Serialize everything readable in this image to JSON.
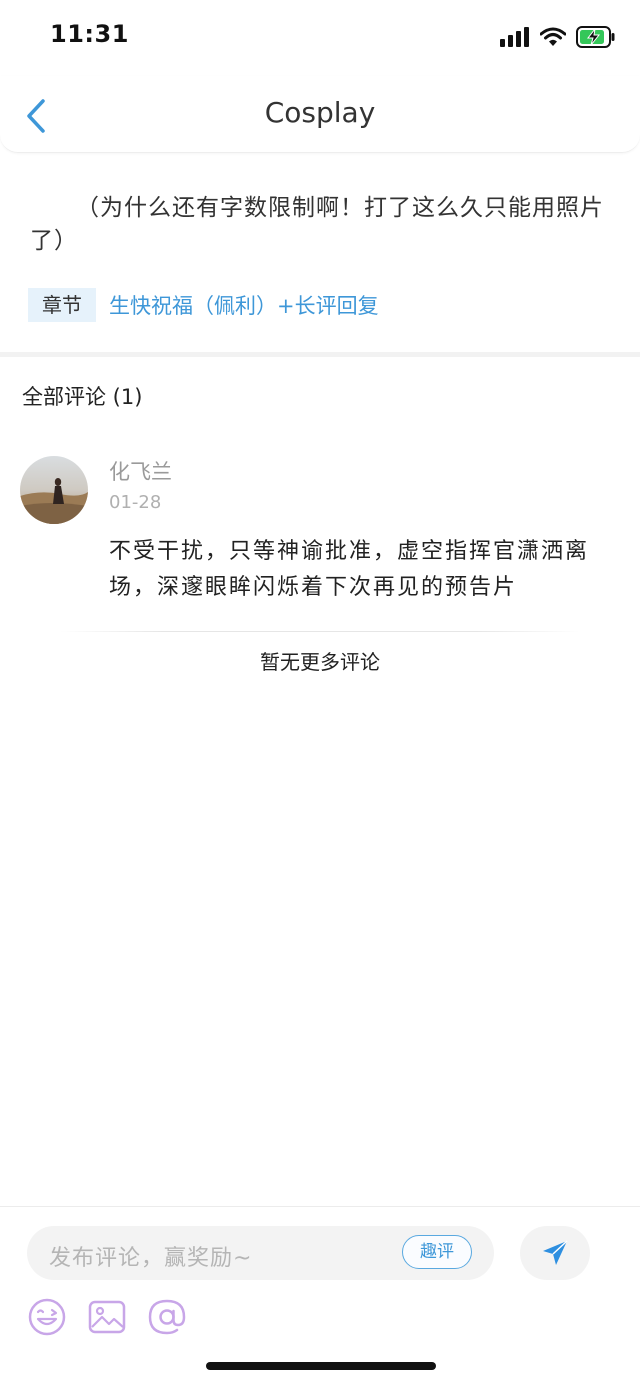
{
  "status_bar": {
    "time": "11:31"
  },
  "nav": {
    "title": "Cosplay"
  },
  "post": {
    "text": "（为什么还有字数限制啊！打了这么久只能用照片了）",
    "chapter_tag": "章节",
    "chapter_link": "生快祝福（佩利）+长评回复"
  },
  "comments": {
    "heading": "全部评论 (1)",
    "items": [
      {
        "user": "化飞兰",
        "date": "01-28",
        "text": "不受干扰，只等神谕批准，虚空指挥官潇洒离场，深邃眼眸闪烁着下次再见的预告片"
      }
    ],
    "no_more": "暂无更多评论"
  },
  "composer": {
    "placeholder": "发布评论，赢奖励~",
    "fun_review_label": "趣评"
  },
  "icons": {
    "back": "chevron-left-icon",
    "send": "send-icon",
    "emoji": "emoji-icon",
    "image": "image-icon",
    "mention": "at-icon"
  },
  "colors": {
    "accent": "#3e97d8",
    "tool_icon": "#c8a6e8"
  }
}
